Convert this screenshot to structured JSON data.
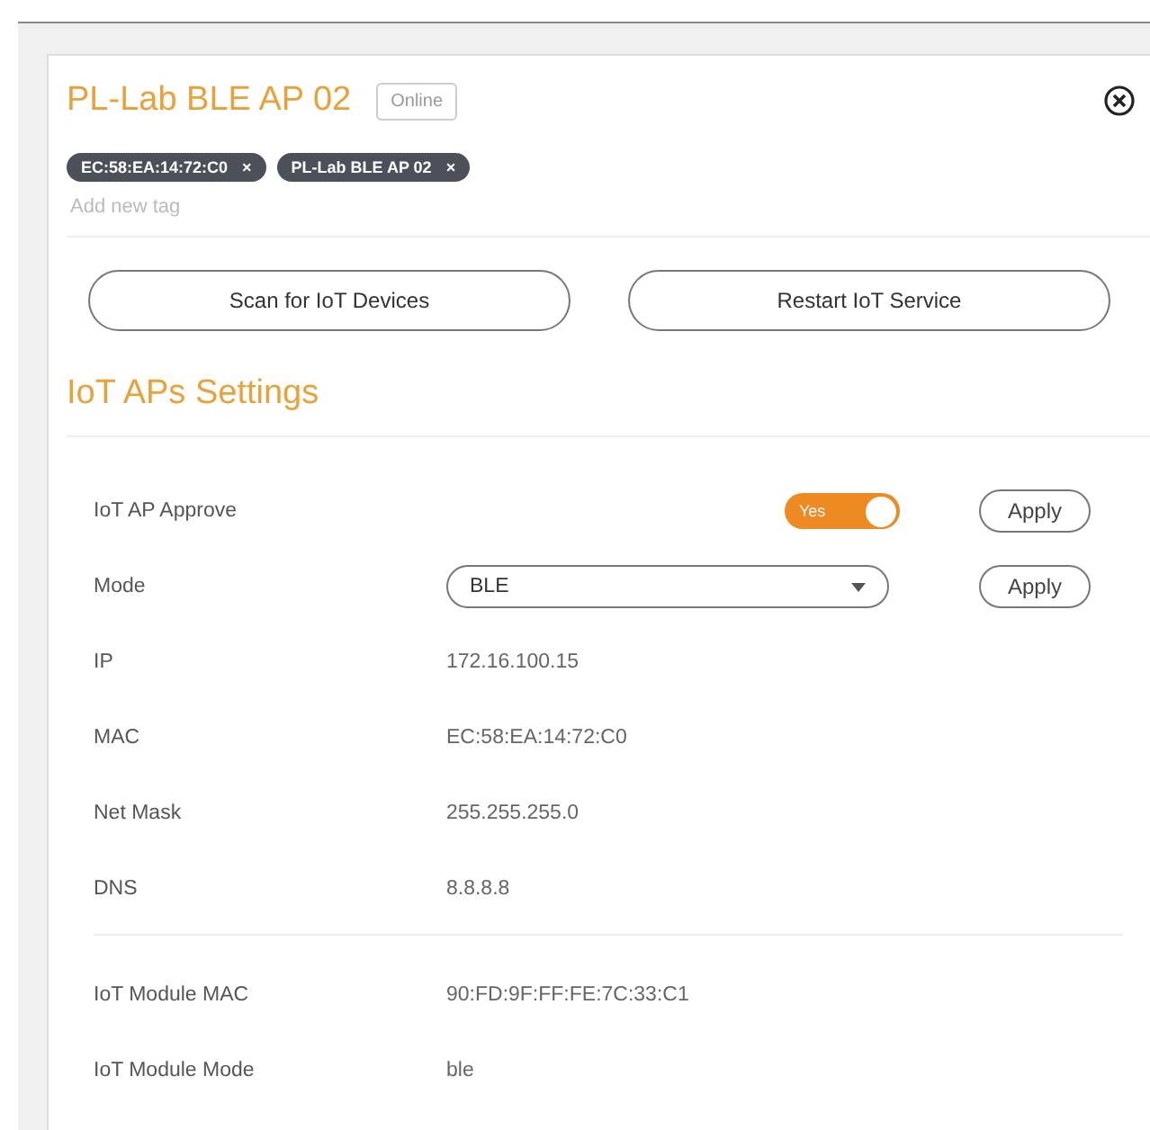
{
  "device": {
    "name": "PL-Lab BLE AP 02",
    "status": "Online"
  },
  "tags": [
    {
      "label": "EC:58:EA:14:72:C0",
      "remove": "×"
    },
    {
      "label": "PL-Lab BLE AP 02",
      "remove": "×"
    }
  ],
  "tag_input": {
    "placeholder": "Add new tag"
  },
  "actions": [
    "Scan for IoT Devices",
    "Restart IoT Service"
  ],
  "section": {
    "title": "IoT APs Settings"
  },
  "settings": [
    {
      "kind": "toggle",
      "label": "IoT AP Approve",
      "on": true,
      "on_text": "Yes",
      "action": "Apply"
    },
    {
      "kind": "select",
      "label": "Mode",
      "value": "BLE",
      "action": "Apply"
    }
  ],
  "info_groups": [
    [
      {
        "label": "IP",
        "value": "172.16.100.15"
      },
      {
        "label": "MAC",
        "value": "EC:58:EA:14:72:C0"
      },
      {
        "label": "Net Mask",
        "value": "255.255.255.0"
      },
      {
        "label": "DNS",
        "value": "8.8.8.8"
      }
    ],
    [
      {
        "label": "IoT Module MAC",
        "value": "90:FD:9F:FF:FE:7C:33:C1"
      },
      {
        "label": "IoT Module Mode",
        "value": "ble"
      }
    ]
  ]
}
